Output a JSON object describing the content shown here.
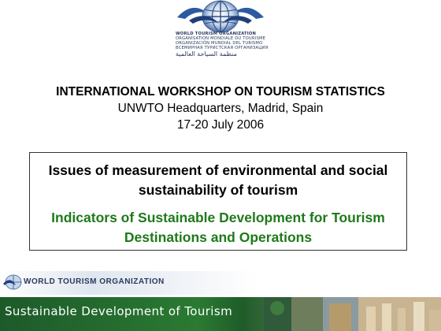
{
  "header": {
    "org_names": [
      "WORLD TOURISM ORGANIZATION",
      "ORGANISATION MONDIALE DU TOURISME",
      "ORGANIZACIÓN MUNDIAL DEL TURISMO",
      "ВСЕМИРНАЯ ТУРИСТСКАЯ ОРГАНИЗАЦИЯ",
      "منظمة السياحة العالمية"
    ]
  },
  "workshop": {
    "title": "INTERNATIONAL WORKSHOP ON TOURISM STATISTICS",
    "location": "UNWTO Headquarters, Madrid, Spain",
    "dates": "17-20 July 2006"
  },
  "presentation": {
    "main_title": "Issues of measurement of environmental and social sustainability of tourism",
    "subtitle": "Indicators of Sustainable Development for Tourism Destinations and Operations"
  },
  "footer": {
    "org_label": "WORLD TOURISM ORGANIZATION",
    "banner_text": "Sustainable Development of Tourism"
  },
  "colors": {
    "subtitle_green": "#1e7a1a",
    "banner_green": "#2a7a32",
    "logo_navy": "#2a3a5c"
  }
}
